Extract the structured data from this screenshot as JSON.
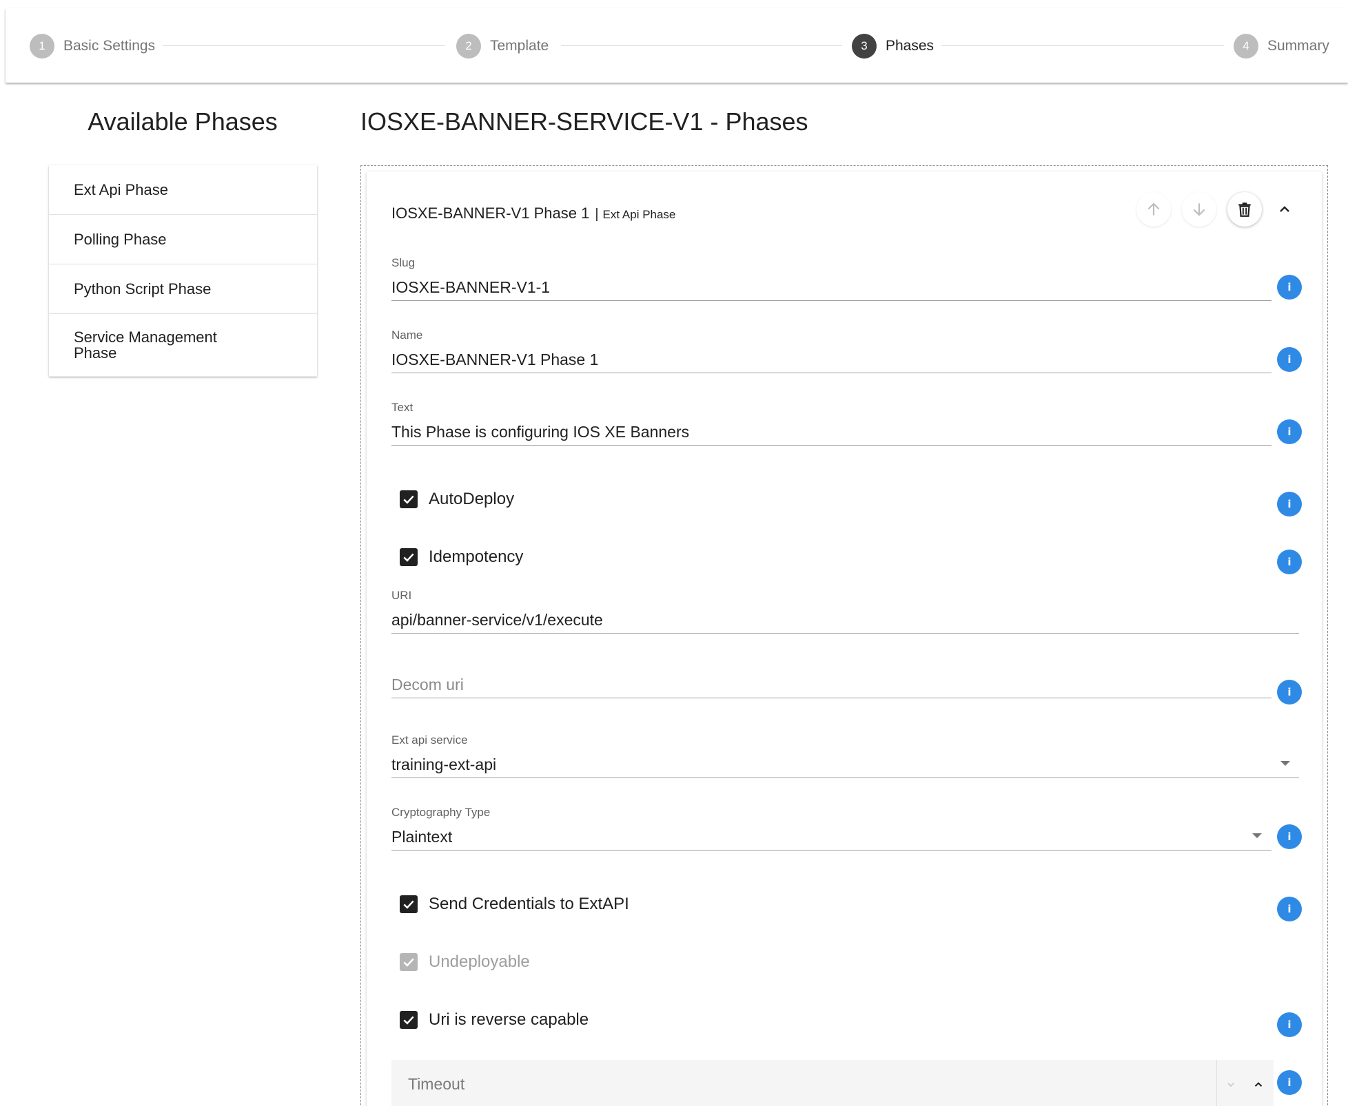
{
  "stepper": {
    "steps": [
      {
        "number": "1",
        "label": "Basic Settings",
        "state": "inactive"
      },
      {
        "number": "2",
        "label": "Template",
        "state": "inactive"
      },
      {
        "number": "3",
        "label": "Phases",
        "state": "active"
      },
      {
        "number": "4",
        "label": "Summary",
        "state": "inactive"
      }
    ]
  },
  "palette": {
    "title": "Available Phases",
    "items": [
      {
        "label": "Ext Api Phase"
      },
      {
        "label": "Polling Phase"
      },
      {
        "label": "Python Script Phase"
      },
      {
        "label": "Service Management Phase"
      }
    ]
  },
  "main": {
    "title": "IOSXE-BANNER-SERVICE-V1 - Phases",
    "card": {
      "title": "IOSXE-BANNER-V1 Phase 1",
      "separator": "|",
      "type": "Ext Api Phase",
      "actions": {
        "move_up_icon": "arrow-up-icon",
        "move_down_icon": "arrow-down-icon",
        "delete_icon": "trash-icon",
        "collapse_icon": "chevron-up-icon"
      },
      "fields": {
        "slug": {
          "label": "Slug",
          "value": "IOSXE-BANNER-V1-1"
        },
        "name": {
          "label": "Name",
          "value": "IOSXE-BANNER-V1 Phase 1"
        },
        "text": {
          "label": "Text",
          "value": "This Phase is configuring IOS XE Banners"
        },
        "uri": {
          "label": "URI",
          "value": "api/banner-service/v1/execute"
        },
        "decom_uri": {
          "placeholder": "Decom uri"
        },
        "ext_api_service": {
          "label": "Ext api service",
          "value": "training-ext-api"
        },
        "cryptography_type": {
          "label": "Cryptography Type",
          "value": "Plaintext"
        },
        "timeout": {
          "placeholder": "Timeout"
        }
      },
      "checkboxes": {
        "autodeploy": {
          "label": "AutoDeploy",
          "checked": true
        },
        "idempotency": {
          "label": "Idempotency",
          "checked": true
        },
        "send_credentials": {
          "label": "Send Credentials to ExtAPI",
          "checked": true
        },
        "undeployable": {
          "label": "Undeployable",
          "checked": true,
          "disabled": true
        },
        "uri_reverse": {
          "label": "Uri is reverse capable",
          "checked": true
        }
      },
      "info_icon": "i"
    }
  },
  "colors": {
    "info_blue": "#2f8ae6",
    "active_step": "#424242",
    "inactive_step": "#bdbdbd"
  }
}
